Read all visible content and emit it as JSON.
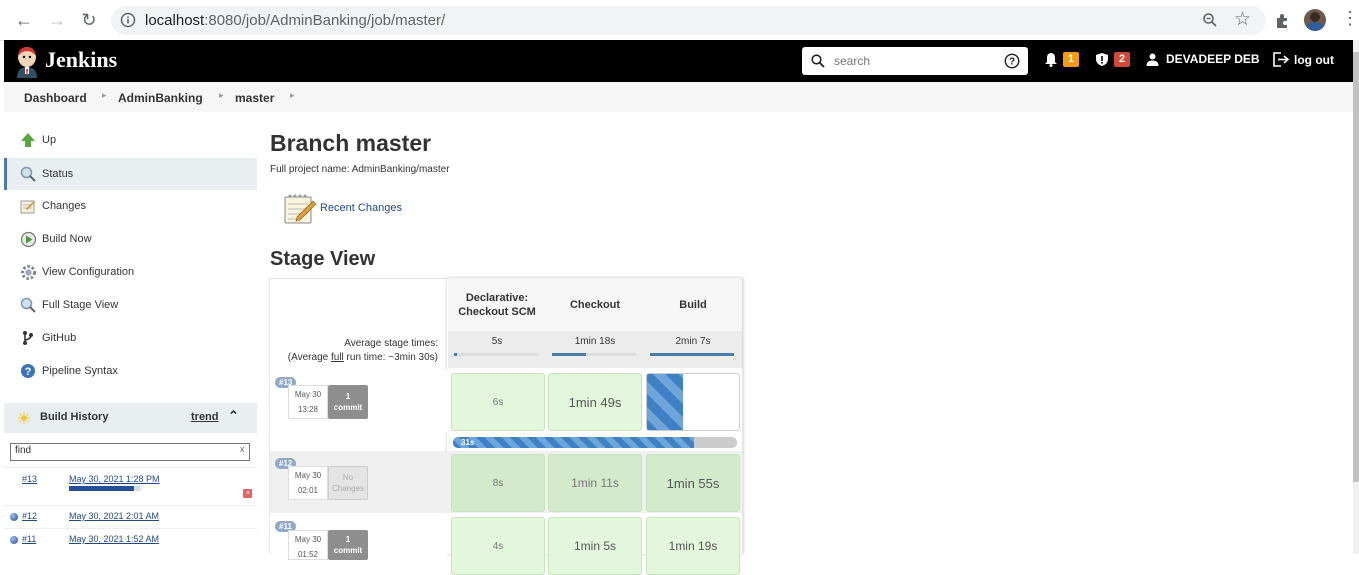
{
  "browser": {
    "url_host": "localhost",
    "url_path": ":8080/job/AdminBanking/job/master/"
  },
  "header": {
    "brand": "Jenkins",
    "search_placeholder": "search",
    "notifications_count": "1",
    "security_count": "2",
    "user_name": "DEVADEEP DEB",
    "logout_label": "log out",
    "colors": {
      "bar": "#000000",
      "notif_badge": "#f39c12",
      "security_badge": "#d24939"
    }
  },
  "breadcrumb": [
    "Dashboard",
    "AdminBanking",
    "master"
  ],
  "sidebar": {
    "tasks": [
      {
        "label": "Up",
        "icon": "up-arrow-icon"
      },
      {
        "label": "Status",
        "icon": "search-icon"
      },
      {
        "label": "Changes",
        "icon": "notepad-icon"
      },
      {
        "label": "Build Now",
        "icon": "clock-play-icon"
      },
      {
        "label": "View Configuration",
        "icon": "gear-icon"
      },
      {
        "label": "Full Stage View",
        "icon": "search-icon"
      },
      {
        "label": "GitHub",
        "icon": "git-branch-icon"
      },
      {
        "label": "Pipeline Syntax",
        "icon": "help-icon"
      }
    ],
    "build_history": {
      "title": "Build History",
      "trend_label": "trend",
      "find_value": "find",
      "find_clear": "x",
      "builds": [
        {
          "number": "#13",
          "date": "May 30, 2021 1:28 PM",
          "progress": 0.9
        },
        {
          "number": "#12",
          "date": "May 30, 2021 2:01 AM"
        },
        {
          "number": "#11",
          "date": "May 30, 2021 1:52 AM"
        }
      ]
    }
  },
  "main": {
    "title": "Branch master",
    "full_name": "Full project name: AdminBanking/master",
    "recent_changes": "Recent Changes",
    "stage_view_title": "Stage View",
    "avg_label": "Average stage times:",
    "avg_run_prefix": "(Average ",
    "avg_run_full": "full",
    "avg_run_suffix": " run time: ~3min 30s)",
    "stages": [
      {
        "name_line1": "Declarative:",
        "name_line2": "Checkout SCM",
        "avg": "5s",
        "avg_fill": 0.03
      },
      {
        "name_line1": "Checkout",
        "name_line2": "",
        "avg": "1min 18s",
        "avg_fill": 0.4
      },
      {
        "name_line1": "Build",
        "name_line2": "",
        "avg": "2min 7s",
        "avg_fill": 1.0
      }
    ],
    "runs": [
      {
        "tag": "#13",
        "date": "May 30",
        "time": "13:28",
        "commit_line1": "1",
        "commit_line2": "commit",
        "cells": [
          "6s",
          "1min 49s",
          ""
        ],
        "running_progress_label": "31s",
        "running_progress": 0.85
      },
      {
        "tag": "#12",
        "date": "May 30",
        "time": "02:01",
        "commit_line1": "No",
        "commit_line2": "Changes",
        "cells": [
          "8s",
          "1min 11s",
          "1min 55s"
        ]
      },
      {
        "tag": "#11",
        "date": "May 30",
        "time": "01:52",
        "commit_line1": "1",
        "commit_line2": "commit",
        "cells": [
          "4s",
          "1min 5s",
          "1min 19s"
        ]
      }
    ]
  }
}
